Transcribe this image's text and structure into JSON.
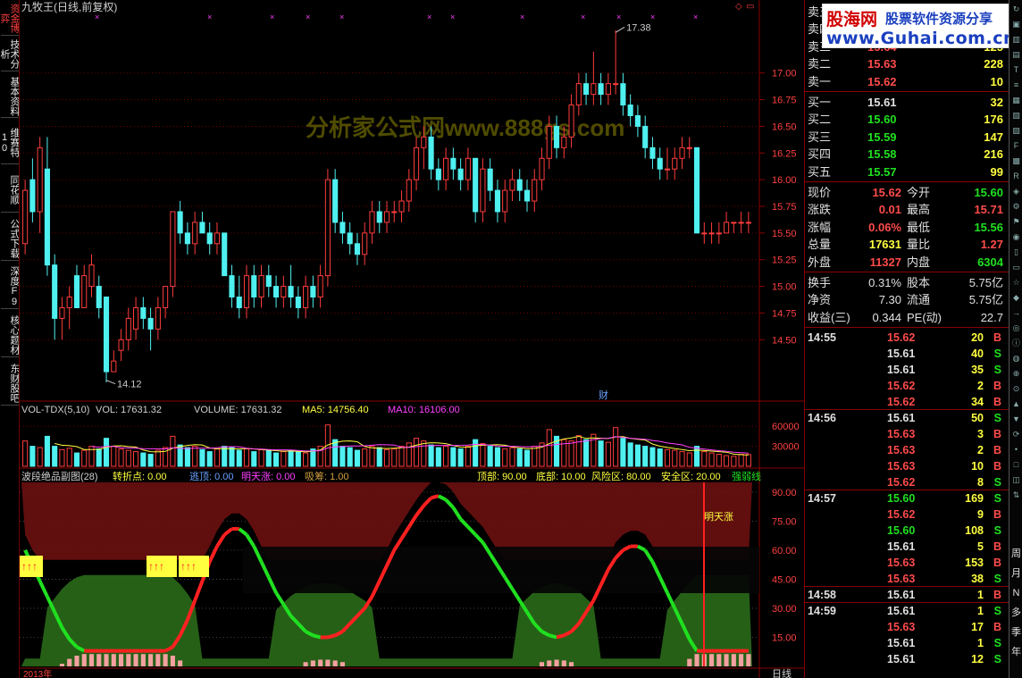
{
  "window": {
    "title": "九牧王(日线,前复权)",
    "left_tab_top": "资金博弈"
  },
  "left_tabs": [
    "技术分析",
    "基本资料",
    "维赛特10",
    "同花顺",
    "公式下载",
    "深度F9",
    "核心题材",
    "东财股吧"
  ],
  "chart_data": [
    {
      "type": "candlestick",
      "title": "九牧王(日线,前复权)",
      "ylim": [
        14.0,
        17.5
      ],
      "yticks": [
        "17.00",
        "16.75",
        "16.50",
        "16.25",
        "16.00",
        "15.75",
        "15.50",
        "15.25",
        "15.00",
        "14.75",
        "14.50"
      ],
      "annotations": {
        "high": "17.38",
        "low": "14.12",
        "marker": "财"
      },
      "watermark": "分析家公式网www.888gs.com",
      "candles_ohlc": [
        [
          15.4,
          16.0,
          15.3,
          15.9
        ],
        [
          16.0,
          16.2,
          15.6,
          15.7
        ],
        [
          15.7,
          16.4,
          15.5,
          16.3
        ],
        [
          16.1,
          16.4,
          15.1,
          15.2
        ],
        [
          15.2,
          15.3,
          14.5,
          14.7
        ],
        [
          14.7,
          14.9,
          14.5,
          14.8
        ],
        [
          14.8,
          15.0,
          14.6,
          14.9
        ],
        [
          15.1,
          15.2,
          14.8,
          14.8
        ],
        [
          14.8,
          15.2,
          14.8,
          15.1
        ],
        [
          15.0,
          15.3,
          14.9,
          15.2
        ],
        [
          15.0,
          15.1,
          14.7,
          14.8
        ],
        [
          14.9,
          14.9,
          14.1,
          14.2
        ],
        [
          14.2,
          14.4,
          14.2,
          14.3
        ],
        [
          14.4,
          14.6,
          14.3,
          14.5
        ],
        [
          14.5,
          14.8,
          14.4,
          14.7
        ],
        [
          14.6,
          14.9,
          14.5,
          14.8
        ],
        [
          14.8,
          14.9,
          14.6,
          14.7
        ],
        [
          14.7,
          14.8,
          14.4,
          14.6
        ],
        [
          14.6,
          14.9,
          14.5,
          14.8
        ],
        [
          14.8,
          15.0,
          14.7,
          15.0
        ],
        [
          15.0,
          15.7,
          14.9,
          15.7
        ],
        [
          15.7,
          15.8,
          15.4,
          15.5
        ],
        [
          15.5,
          15.6,
          15.3,
          15.4
        ],
        [
          15.4,
          15.7,
          15.3,
          15.6
        ],
        [
          15.6,
          15.7,
          15.5,
          15.5
        ],
        [
          15.5,
          15.6,
          15.3,
          15.4
        ],
        [
          15.4,
          15.6,
          15.3,
          15.5
        ],
        [
          15.5,
          15.5,
          15.1,
          15.1
        ],
        [
          15.1,
          15.2,
          14.8,
          14.9
        ],
        [
          14.9,
          15.1,
          14.7,
          14.8
        ],
        [
          14.8,
          15.2,
          14.7,
          15.1
        ],
        [
          15.1,
          15.2,
          14.8,
          14.9
        ],
        [
          14.9,
          15.2,
          14.8,
          15.1
        ],
        [
          15.1,
          15.2,
          14.9,
          15.0
        ],
        [
          15.0,
          15.1,
          14.8,
          14.9
        ],
        [
          14.9,
          15.1,
          14.8,
          15.0
        ],
        [
          15.0,
          15.2,
          14.8,
          14.9
        ],
        [
          14.9,
          15.0,
          14.7,
          14.8
        ],
        [
          14.8,
          15.1,
          14.7,
          15.0
        ],
        [
          15.0,
          15.1,
          14.8,
          14.9
        ],
        [
          14.9,
          15.2,
          14.8,
          15.1
        ],
        [
          15.1,
          16.1,
          15.0,
          16.0
        ],
        [
          16.0,
          16.1,
          15.5,
          15.6
        ],
        [
          15.6,
          15.7,
          15.4,
          15.5
        ],
        [
          15.5,
          15.6,
          15.3,
          15.4
        ],
        [
          15.4,
          15.5,
          15.2,
          15.3
        ],
        [
          15.3,
          15.6,
          15.2,
          15.5
        ],
        [
          15.5,
          15.8,
          15.4,
          15.7
        ],
        [
          15.7,
          15.8,
          15.5,
          15.6
        ],
        [
          15.6,
          15.8,
          15.5,
          15.7
        ],
        [
          15.7,
          15.8,
          15.6,
          15.7
        ],
        [
          15.7,
          15.9,
          15.6,
          15.8
        ],
        [
          15.8,
          16.1,
          15.7,
          16.0
        ],
        [
          16.0,
          16.4,
          15.9,
          16.3
        ],
        [
          16.3,
          16.5,
          16.1,
          16.4
        ],
        [
          16.4,
          16.5,
          16.0,
          16.1
        ],
        [
          16.1,
          16.2,
          15.9,
          16.0
        ],
        [
          16.0,
          16.3,
          15.9,
          16.2
        ],
        [
          16.2,
          16.3,
          16.0,
          16.1
        ],
        [
          16.1,
          16.2,
          15.9,
          16.0
        ],
        [
          16.0,
          16.3,
          15.9,
          16.2
        ],
        [
          16.2,
          16.2,
          15.6,
          15.7
        ],
        [
          15.7,
          16.2,
          15.6,
          16.1
        ],
        [
          16.1,
          16.2,
          15.8,
          15.9
        ],
        [
          15.9,
          16.0,
          15.6,
          15.7
        ],
        [
          15.7,
          16.0,
          15.6,
          15.9
        ],
        [
          15.9,
          16.1,
          15.8,
          16.0
        ],
        [
          16.0,
          16.1,
          15.8,
          15.9
        ],
        [
          15.9,
          16.0,
          15.7,
          15.8
        ],
        [
          15.8,
          16.1,
          15.7,
          16.0
        ],
        [
          16.0,
          16.3,
          15.9,
          16.2
        ],
        [
          16.2,
          16.6,
          16.1,
          16.5
        ],
        [
          16.5,
          16.6,
          16.2,
          16.3
        ],
        [
          16.3,
          16.5,
          16.2,
          16.4
        ],
        [
          16.4,
          16.8,
          16.3,
          16.7
        ],
        [
          16.7,
          17.0,
          16.6,
          16.9
        ],
        [
          16.9,
          17.0,
          16.7,
          16.8
        ],
        [
          16.8,
          17.2,
          16.7,
          16.9
        ],
        [
          16.9,
          17.0,
          16.7,
          16.8
        ],
        [
          16.8,
          17.0,
          16.7,
          16.9
        ],
        [
          16.9,
          17.4,
          16.8,
          16.9
        ],
        [
          16.9,
          17.0,
          16.6,
          16.7
        ],
        [
          16.7,
          16.8,
          16.5,
          16.6
        ],
        [
          16.6,
          16.7,
          16.4,
          16.5
        ],
        [
          16.5,
          16.6,
          16.2,
          16.3
        ],
        [
          16.3,
          16.4,
          16.1,
          16.2
        ],
        [
          16.2,
          16.3,
          16.0,
          16.1
        ],
        [
          16.1,
          16.3,
          16.0,
          16.1
        ],
        [
          16.1,
          16.3,
          16.0,
          16.2
        ],
        [
          16.2,
          16.4,
          16.1,
          16.3
        ],
        [
          16.3,
          16.4,
          16.2,
          16.3
        ],
        [
          16.3,
          16.3,
          15.5,
          15.5
        ],
        [
          15.5,
          15.6,
          15.4,
          15.5
        ],
        [
          15.5,
          15.6,
          15.4,
          15.5
        ],
        [
          15.5,
          15.6,
          15.4,
          15.5
        ],
        [
          15.5,
          15.7,
          15.5,
          15.6
        ],
        [
          15.6,
          15.6,
          15.5,
          15.6
        ],
        [
          15.6,
          15.7,
          15.5,
          15.6
        ],
        [
          15.6,
          15.7,
          15.5,
          15.6
        ]
      ]
    },
    {
      "type": "bar",
      "title": "VOL-TDX(5,10)",
      "legend": [
        "VOL: 17631.32",
        "VOLUME: 17631.32",
        "MA5: 14756.40",
        "MA10: 16106.00"
      ],
      "yticks": [
        "60000",
        "30000"
      ],
      "ylim": [
        0,
        75000
      ],
      "values": [
        38000,
        30000,
        28000,
        45000,
        30000,
        25000,
        27000,
        20000,
        24000,
        30000,
        26000,
        42000,
        30000,
        26000,
        24000,
        22000,
        20000,
        18000,
        24000,
        28000,
        45000,
        32000,
        28000,
        30000,
        25000,
        22000,
        26000,
        30000,
        28000,
        24000,
        26000,
        22000,
        25000,
        24000,
        20000,
        22000,
        24000,
        22000,
        20000,
        26000,
        30000,
        62000,
        40000,
        30000,
        28000,
        24000,
        26000,
        30000,
        28000,
        25000,
        26000,
        30000,
        35000,
        42000,
        38000,
        32000,
        28000,
        30000,
        28000,
        26000,
        30000,
        40000,
        34000,
        30000,
        28000,
        26000,
        28000,
        26000,
        24000,
        30000,
        35000,
        55000,
        45000,
        40000,
        38000,
        46000,
        40000,
        48000,
        38000,
        36000,
        58000,
        42000,
        35000,
        32000,
        30000,
        28000,
        26000,
        25000,
        24000,
        22000,
        20000,
        30000,
        22000,
        20000,
        18000,
        16000,
        15000,
        18000,
        17631
      ]
    },
    {
      "type": "indicator",
      "title": "波段绝品副图(28)",
      "legend": [
        "转折点: 0.00",
        "逃顶: 0.00",
        "明天涨: 0.00",
        "吸筹: 1.00",
        "顶部: 90.00",
        "底部: 10.00",
        "风险区: 80.00",
        "安全区: 20.00",
        "强弱线"
      ],
      "yticks": [
        "90.00",
        "75.00",
        "60.00",
        "45.00",
        "30.00",
        "15.00"
      ],
      "ylim": [
        0,
        95
      ],
      "series": [
        {
          "name": "强弱线",
          "values": [
            60,
            52,
            44,
            36,
            28,
            20,
            14,
            10,
            8,
            8,
            8,
            8,
            8,
            8,
            8,
            8,
            8,
            8,
            8,
            8,
            10,
            16,
            24,
            34,
            44,
            54,
            62,
            68,
            71,
            71,
            68,
            62,
            54,
            46,
            38,
            32,
            26,
            22,
            18,
            16,
            15,
            15,
            16,
            18,
            22,
            26,
            30,
            36,
            44,
            52,
            60,
            66,
            72,
            78,
            83,
            87,
            88,
            86,
            82,
            76,
            72,
            68,
            64,
            58,
            52,
            46,
            40,
            34,
            28,
            22,
            18,
            16,
            15,
            16,
            18,
            22,
            28,
            34,
            42,
            50,
            56,
            60,
            62,
            62,
            60,
            54,
            46,
            38,
            30,
            22,
            14,
            8,
            8,
            8,
            8,
            8,
            8,
            8,
            8
          ]
        }
      ],
      "labels": [
        "明天涨"
      ]
    }
  ],
  "quote": {
    "sell": [
      {
        "label": "卖五",
        "price": "",
        "vol": ""
      },
      {
        "label": "卖四",
        "price": "",
        "vol": ""
      },
      {
        "label": "卖三",
        "price": "15.64",
        "vol": "125"
      },
      {
        "label": "卖二",
        "price": "15.63",
        "vol": "228"
      },
      {
        "label": "卖一",
        "price": "15.62",
        "vol": "10"
      }
    ],
    "buy": [
      {
        "label": "买一",
        "price": "15.61",
        "vol": "32"
      },
      {
        "label": "买二",
        "price": "15.60",
        "vol": "176"
      },
      {
        "label": "买三",
        "price": "15.59",
        "vol": "147"
      },
      {
        "label": "买四",
        "price": "15.58",
        "vol": "216"
      },
      {
        "label": "买五",
        "price": "15.57",
        "vol": "99"
      }
    ],
    "stats1": [
      {
        "k1": "现价",
        "v1": "15.62",
        "c1": "#ff4b4b",
        "k2": "今开",
        "v2": "15.60",
        "c2": "#20e020"
      },
      {
        "k1": "涨跌",
        "v1": "0.01",
        "c1": "#ff4b4b",
        "k2": "最高",
        "v2": "15.71",
        "c2": "#ff4b4b"
      },
      {
        "k1": "涨幅",
        "v1": "0.06%",
        "c1": "#ff4b4b",
        "k2": "最低",
        "v2": "15.56",
        "c2": "#20e020"
      },
      {
        "k1": "总量",
        "v1": "17631",
        "c1": "#ffff40",
        "k2": "量比",
        "v2": "1.27",
        "c2": "#ff4b4b"
      },
      {
        "k1": "外盘",
        "v1": "11327",
        "c1": "#ff4b4b",
        "k2": "内盘",
        "v2": "6304",
        "c2": "#20e020"
      }
    ],
    "stats2": [
      {
        "k1": "换手",
        "v1": "0.31%",
        "k2": "股本",
        "v2": "5.75亿"
      },
      {
        "k1": "净资",
        "v1": "7.30",
        "k2": "流通",
        "v2": "5.75亿"
      },
      {
        "k1": "收益(三)",
        "v1": "0.344",
        "k2": "PE(动)",
        "v2": "22.7"
      }
    ]
  },
  "ticks": [
    {
      "time": "14:55",
      "price": "15.62",
      "vol": "20",
      "side": "B"
    },
    {
      "time": "",
      "price": "15.61",
      "vol": "40",
      "side": "S"
    },
    {
      "time": "",
      "price": "15.61",
      "vol": "35",
      "side": "S"
    },
    {
      "time": "",
      "price": "15.62",
      "vol": "2",
      "side": "B"
    },
    {
      "time": "",
      "price": "15.62",
      "vol": "34",
      "side": "B"
    },
    {
      "time": "14:56",
      "price": "15.61",
      "vol": "50",
      "side": "S"
    },
    {
      "time": "",
      "price": "15.63",
      "vol": "3",
      "side": "B"
    },
    {
      "time": "",
      "price": "15.63",
      "vol": "2",
      "side": "B"
    },
    {
      "time": "",
      "price": "15.63",
      "vol": "10",
      "side": "B"
    },
    {
      "time": "",
      "price": "15.62",
      "vol": "8",
      "side": "S"
    },
    {
      "time": "14:57",
      "price": "15.60",
      "vol": "169",
      "side": "S"
    },
    {
      "time": "",
      "price": "15.62",
      "vol": "9",
      "side": "B"
    },
    {
      "time": "",
      "price": "15.60",
      "vol": "108",
      "side": "S"
    },
    {
      "time": "",
      "price": "15.61",
      "vol": "5",
      "side": "B"
    },
    {
      "time": "",
      "price": "15.63",
      "vol": "153",
      "side": "B"
    },
    {
      "time": "",
      "price": "15.63",
      "vol": "38",
      "side": "S"
    },
    {
      "time": "14:58",
      "price": "15.61",
      "vol": "1",
      "side": "B"
    },
    {
      "time": "14:59",
      "price": "15.61",
      "vol": "1",
      "side": "S"
    },
    {
      "time": "",
      "price": "15.63",
      "vol": "17",
      "side": "B"
    },
    {
      "time": "",
      "price": "15.61",
      "vol": "1",
      "side": "S"
    },
    {
      "time": "",
      "price": "15.61",
      "vol": "12",
      "side": "S"
    }
  ],
  "right_toolbar": [
    "周",
    "月",
    "N",
    "多",
    "季",
    "年"
  ],
  "watermark_site": {
    "name": "股海网",
    "slogan": "股票软件资源分享",
    "url": "www.Guhai.com.cn"
  },
  "bottom": {
    "period_label": "日线",
    "year_label": "2013年"
  },
  "colors": {
    "up": "#ff3c3c",
    "down": "#4ff0f0",
    "grid": "#8a0000",
    "green": "#20e020",
    "yellow": "#ffff40",
    "magenta": "#ff40ff"
  }
}
